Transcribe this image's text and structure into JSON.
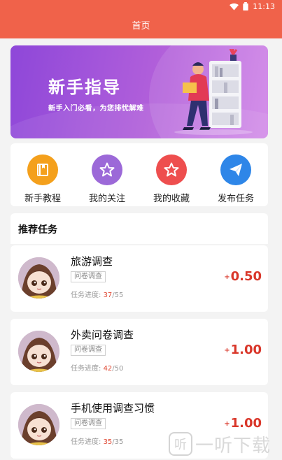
{
  "status_bar": {
    "time": "11:13",
    "icons": [
      "wifi-icon",
      "battery-icon"
    ]
  },
  "header": {
    "title": "首页"
  },
  "banner": {
    "title": "新手指导",
    "subtitle": "新手入门必看，为您排忧解难",
    "colors": {
      "from": "#8e47d9",
      "to": "#cf82e7"
    }
  },
  "menu": {
    "items": [
      {
        "label": "新手教程",
        "icon": "book-icon",
        "color": "#f4a01c"
      },
      {
        "label": "我的关注",
        "icon": "star-outline-icon",
        "color": "#9c69d8"
      },
      {
        "label": "我的收藏",
        "icon": "star-outline-icon",
        "color": "#ee4e4e"
      },
      {
        "label": "发布任务",
        "icon": "paper-plane-icon",
        "color": "#2e86e8"
      }
    ]
  },
  "recommend": {
    "title": "推荐任务",
    "tasks": [
      {
        "name": "旅游调查",
        "tag": "问卷调查",
        "progress_label": "任务进度:",
        "progress_done": "37",
        "progress_total": "55",
        "reward_sign": "+",
        "reward": "0.50"
      },
      {
        "name": "外卖问卷调查",
        "tag": "问卷调查",
        "progress_label": "任务进度:",
        "progress_done": "42",
        "progress_total": "50",
        "reward_sign": "+",
        "reward": "1.00"
      },
      {
        "name": "手机使用调查习惯",
        "tag": "问卷调查",
        "progress_label": "任务进度:",
        "progress_done": "35",
        "progress_total": "35",
        "reward_sign": "+",
        "reward": "1.00"
      }
    ]
  },
  "watermark": {
    "logo_char": "听",
    "text": "一听下载"
  },
  "colors": {
    "primary": "#f0624a",
    "reward": "#d9372a"
  }
}
